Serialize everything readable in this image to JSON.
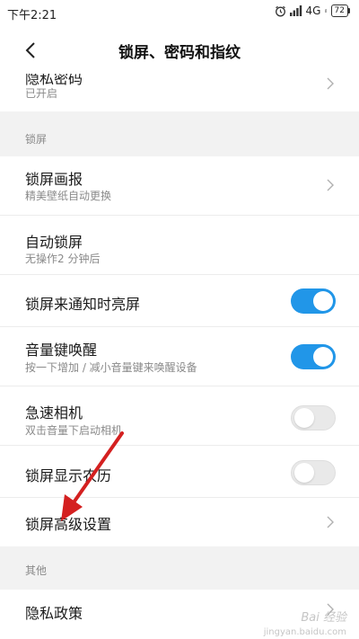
{
  "status": {
    "time": "下午2:21",
    "network": "4G",
    "signal_suffix": "ᵢₗ",
    "battery": "72"
  },
  "header": {
    "title": "锁屏、密码和指纹"
  },
  "privacy_password": {
    "title": "隐私密码",
    "subtitle": "已开启"
  },
  "section_lock": {
    "label": "锁屏"
  },
  "items": [
    {
      "title": "锁屏画报",
      "subtitle": "精美壁纸自动更换",
      "control": "chevron"
    },
    {
      "title": "自动锁屏",
      "subtitle": "无操作2 分钟后",
      "control": "none"
    },
    {
      "title": "锁屏来通知时亮屏",
      "subtitle": "",
      "control": "toggle",
      "on": true
    },
    {
      "title": "音量键唤醒",
      "subtitle": "按一下增加 / 减小音量键来唤醒设备",
      "control": "toggle",
      "on": true
    },
    {
      "title": "急速相机",
      "subtitle": "双击音量下启动相机",
      "control": "toggle",
      "on": false
    },
    {
      "title": "锁屏显示农历",
      "subtitle": "",
      "control": "toggle",
      "on": false
    },
    {
      "title": "锁屏高级设置",
      "subtitle": "",
      "control": "chevron"
    }
  ],
  "section_other": {
    "label": "其他"
  },
  "privacy_policy": {
    "title": "隐私政策"
  },
  "watermark": {
    "text": "Bai 经验",
    "sub": "jingyan.baidu.com"
  },
  "colors": {
    "accent": "#2196e8",
    "annotation_arrow": "#d42020"
  }
}
